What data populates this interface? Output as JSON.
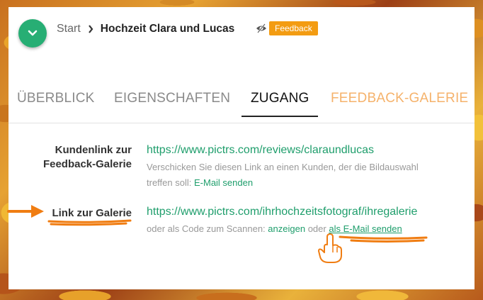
{
  "header": {
    "breadcrumb_start": "Start",
    "title": "Hochzeit Clara und Lucas",
    "feedback_badge": "Feedback"
  },
  "tabs": [
    {
      "label": "ÜBERBLICK"
    },
    {
      "label": "EIGENSCHAFTEN"
    },
    {
      "label": "ZUGANG"
    },
    {
      "label": "FEEDBACK-GALERIE"
    }
  ],
  "access": {
    "client_link": {
      "label_line1": "Kundenlink zur",
      "label_line2": "Feedback-Galerie",
      "url": "https://www.pictrs.com/reviews/claraundlucas",
      "hint_line1": "Verschicken Sie diesen Link an einen Kunden, der die Bildauswahl",
      "hint_line2": "treffen soll:",
      "email_action": "E-Mail senden"
    },
    "gallery_link": {
      "label": "Link zur Galerie",
      "url": "https://www.pictrs.com/ihrhochzeitsfotograf/ihregalerie",
      "hint_prefix": "oder als Code zum Scannen:",
      "show_action": "anzeigen",
      "hint_middle": "oder",
      "email_action": "als E-Mail senden"
    }
  },
  "colors": {
    "accent_green": "#27ae74",
    "badge_orange": "#f39c12",
    "annotation_orange": "#f07d12"
  },
  "icons": [
    "chevron-down-icon",
    "chevron-right-icon",
    "eye-slash-icon",
    "arrow-annotation-icon",
    "pointing-hand-icon"
  ]
}
